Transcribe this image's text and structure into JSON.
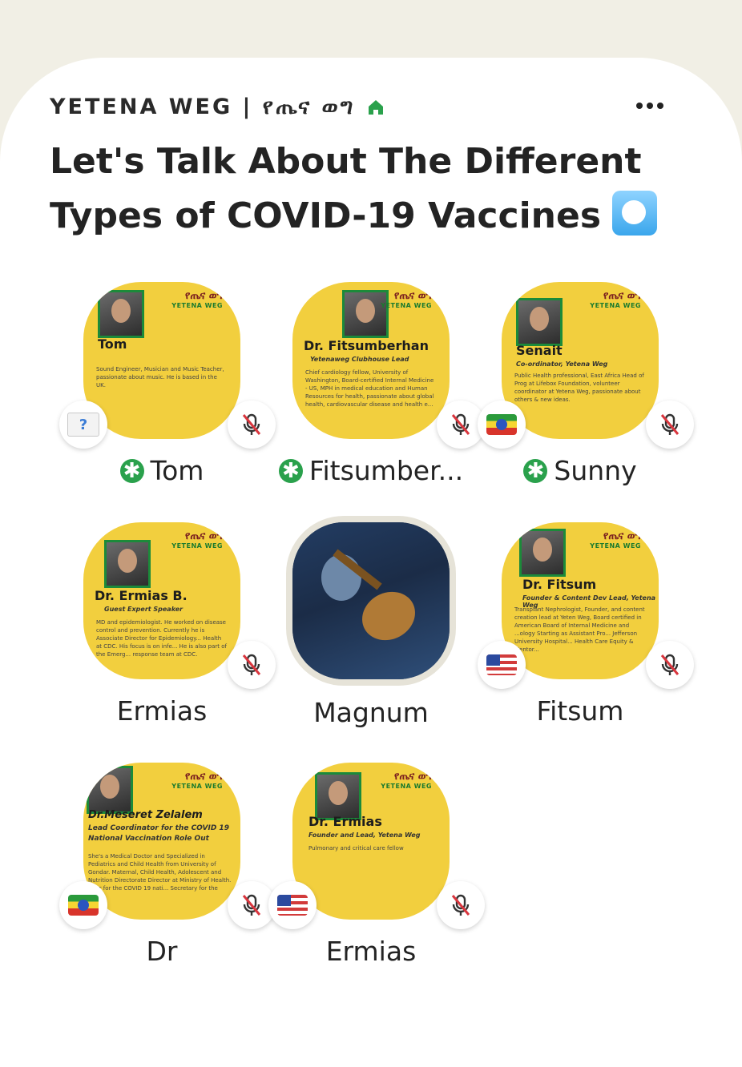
{
  "club": {
    "name": "YETENA WEG | የጤና ወግ"
  },
  "room": {
    "title": "Let's Talk About The Different Types of COVID-19 Vaccines"
  },
  "speakers": [
    {
      "name": "Tom",
      "card_name": "Tom",
      "card_tag": "",
      "card_bio": "Sound Engineer, Musician and Music Teacher, passionate about music. He is based in the UK.",
      "flag": "unknown",
      "moderator": true,
      "muted": true
    },
    {
      "name": "Fitsumber...",
      "card_name": "Dr. Fitsumberhan",
      "card_tag": "Yetenaweg Clubhouse Lead",
      "card_bio": "Chief cardiology fellow, University of Washington, Board-certified Internal Medicine - US, MPH in medical education and Human Resources for health, passionate about global health, cardiovascular disease and health e...",
      "flag": "none",
      "moderator": true,
      "muted": true
    },
    {
      "name": "Sunny",
      "card_name": "Senait",
      "card_tag": "Co-ordinator, Yetena Weg",
      "card_bio": "Public Health professional, East Africa Head of Prog at Lifebox Foundation, volunteer coordinator at Yetena Weg, passionate about others & new ideas.",
      "flag": "ethiopia",
      "moderator": true,
      "muted": true
    },
    {
      "name": "Ermias",
      "card_name": "Dr. Ermias B.",
      "card_tag": "Guest Expert Speaker",
      "card_bio": "MD and epidemiologist. He worked on disease control and prevention. Currently he is Associate Director for Epidemiology... Health at CDC. His focus is on infe... He is also part of the Emerg... response team at CDC.",
      "flag": "none",
      "moderator": false,
      "muted": true
    },
    {
      "name": "Magnum",
      "card_name": "",
      "card_tag": "",
      "card_bio": "",
      "flag": "none",
      "moderator": false,
      "muted": false
    },
    {
      "name": "Fitsum",
      "card_name": "Dr. Fitsum",
      "card_tag": "Founder & Content Dev Lead, Yetena Weg",
      "card_bio": "Transplant Nephrologist, Founder, and content creation lead at Yeten Weg, Board certified in American Board of Internal Medicine and ...ology Starting as Assistant Pro... Jefferson University Hospital... Health Care Equity & Mentor...",
      "flag": "usa",
      "moderator": false,
      "muted": true
    },
    {
      "name": "Dr",
      "card_name": "Dr.Meseret Zelalem",
      "card_tag": "Lead Coordinator for the COVID 19 National Vaccination Role Out",
      "card_bio": "She's a Medical Doctor and Specialized in Pediatrics and Child Health from University of Gondar. Maternal, Child Health, Adolescent and Nutrition Directorate Director at Ministry of Health. ...tor for the COVID 19 nati... Secretary for the Na...",
      "flag": "ethiopia",
      "moderator": false,
      "muted": true
    },
    {
      "name": "Ermias",
      "card_name": "Dr. Ermias",
      "card_tag": "Founder and Lead, Yetena Weg",
      "card_bio": "Pulmonary and critical care fellow",
      "flag": "usa",
      "moderator": false,
      "muted": true
    }
  ],
  "logo": {
    "text": "የጤና ወግ",
    "sub": "YETENA WEG"
  },
  "colors": {
    "card": "#f2cf3e",
    "moderator": "#2aa14c",
    "mute": "#d9363e"
  }
}
